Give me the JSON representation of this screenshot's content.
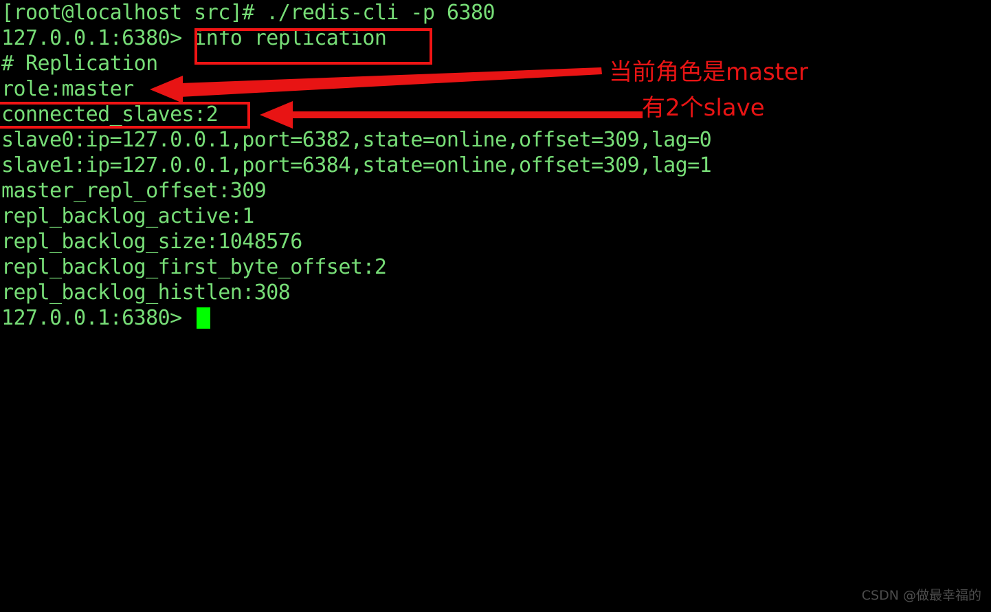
{
  "terminal": {
    "foreground_color": "#77dd77",
    "background_color": "#000000",
    "cursor_color": "#00ff00",
    "lines": [
      "[root@localhost src]# ./redis-cli -p 6380",
      "127.0.0.1:6380> info replication",
      "# Replication",
      "role:master",
      "connected_slaves:2",
      "slave0:ip=127.0.0.1,port=6382,state=online,offset=309,lag=0",
      "slave1:ip=127.0.0.1,port=6384,state=online,offset=309,lag=1",
      "master_repl_offset:309",
      "repl_backlog_active:1",
      "repl_backlog_size:1048576",
      "repl_backlog_first_byte_offset:2",
      "repl_backlog_histlen:308"
    ],
    "prompt_line": "127.0.0.1:6380> "
  },
  "annotations": {
    "accent_color": "#e81414",
    "highlight_boxes": [
      {
        "label": "info replication",
        "name": "info-replication-highlight"
      },
      {
        "label": "connected_slaves:2",
        "name": "connected-slaves-highlight"
      }
    ],
    "callouts": [
      {
        "text": "当前角色是master",
        "target": "role:master"
      },
      {
        "text": "有2个slave",
        "target": "connected_slaves:2"
      }
    ]
  },
  "watermark": {
    "text": "CSDN @做最幸福的"
  }
}
